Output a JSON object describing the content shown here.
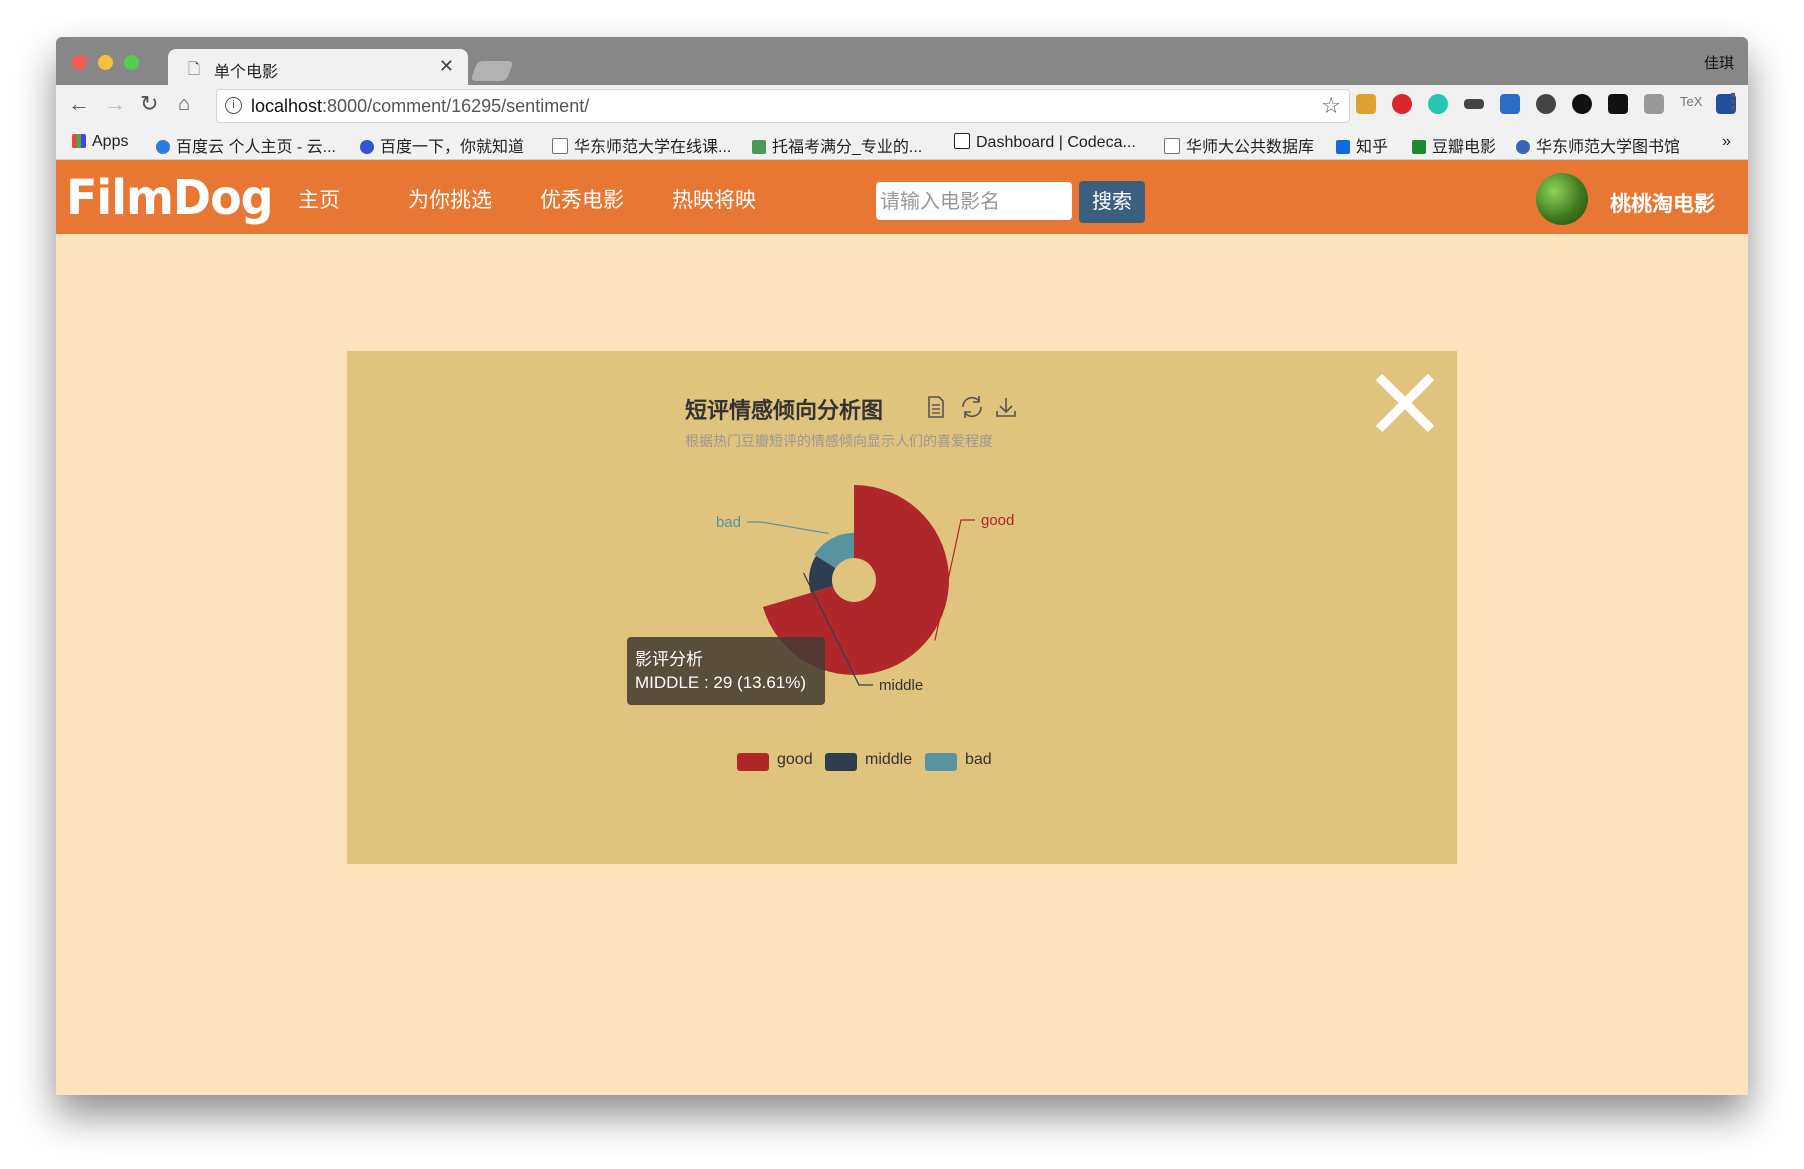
{
  "browser": {
    "tab_title": "单个电影",
    "profile_name": "佳琪",
    "url_host": "localhost",
    "url_rest": ":8000/comment/16295/sentiment/",
    "bookmarks": [
      "Apps",
      "百度云 个人主页 - 云...",
      "百度一下，你就知道",
      "华东师范大学在线课...",
      "托福考满分_专业的...",
      "Dashboard | Codeca...",
      "华师大公共数据库",
      "知乎",
      "豆瓣电影",
      "华东师范大学图书馆"
    ],
    "bookmarks_more": "»"
  },
  "site": {
    "logo": "FilmDog",
    "nav": [
      "主页",
      "为你挑选",
      "优秀电影",
      "热映将映"
    ],
    "search_placeholder": "请输入电影名",
    "search_button": "搜索",
    "user_name": "桃桃淘电影"
  },
  "chart_data": {
    "type": "pie",
    "variant": "nightingale-rose",
    "title": "短评情感倾向分析图",
    "subtitle": "根据热门豆瓣短评的情感倾向显示人们的喜爱程度",
    "series": [
      {
        "name": "good",
        "value": 150,
        "percent": 70.42,
        "color": "#b0272a"
      },
      {
        "name": "middle",
        "value": 29,
        "percent": 13.61,
        "color": "#2e3e4f"
      },
      {
        "name": "bad",
        "value": 34,
        "percent": 15.96,
        "color": "#5894a0"
      }
    ],
    "legend": [
      "good",
      "middle",
      "bad"
    ],
    "legend_position": "bottom",
    "tooltip": {
      "title": "影评分析",
      "text": "MIDDLE : 29 (13.61%)"
    }
  }
}
